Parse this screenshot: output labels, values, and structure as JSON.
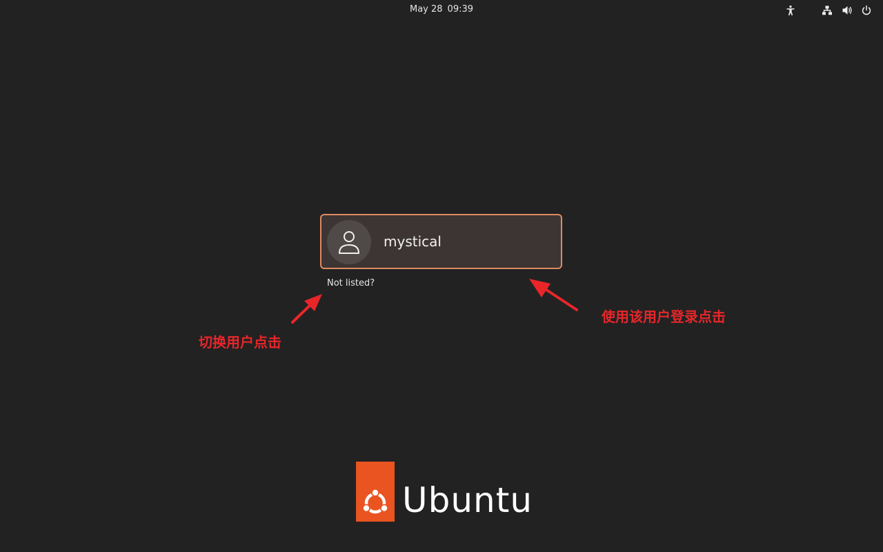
{
  "topbar": {
    "date": "May 28",
    "time": "09:39",
    "icons": [
      "accessibility-icon",
      "network-icon",
      "volume-icon",
      "power-icon"
    ]
  },
  "login": {
    "user_name": "mystical",
    "avatar_icon": "user-avatar-icon",
    "not_listed": "Not listed?"
  },
  "annotations": {
    "switch_user": "切换用户点击",
    "login_with_user": "使用该用户登录点击"
  },
  "branding": {
    "wordmark": "Ubuntu",
    "logo_color": "#e95420",
    "accent_border": "#e08a63",
    "annotation_color": "#e8262a"
  }
}
